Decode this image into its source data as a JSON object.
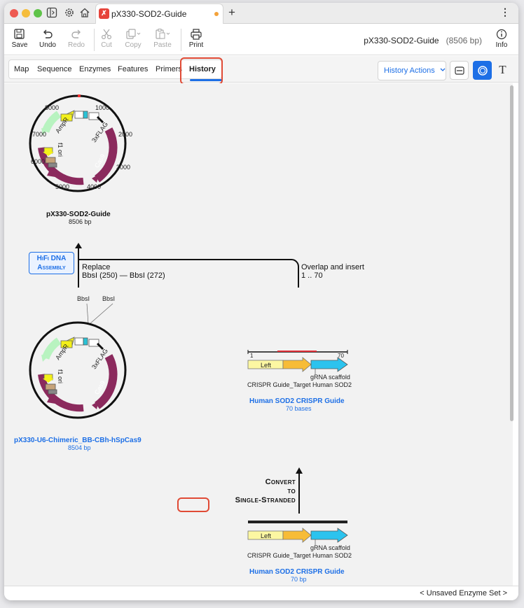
{
  "window": {
    "tab_title": "pX330-SOD2-Guide",
    "tab_logo": "✗",
    "new_tab": "+",
    "menu": "⋮"
  },
  "toolbar": {
    "save": "Save",
    "undo": "Undo",
    "redo": "Redo",
    "cut": "Cut",
    "copy": "Copy",
    "paste": "Paste",
    "print": "Print",
    "info": "Info",
    "doc_name": "pX330-SOD2-Guide",
    "doc_size": "(8506 bp)"
  },
  "view_tabs": [
    "Map",
    "Sequence",
    "Enzymes",
    "Features",
    "Primers",
    "History"
  ],
  "history_actions": "History Actions",
  "canvas": {
    "top_map": {
      "name": "pX330-SOD2-Guide",
      "size": "8506 bp",
      "ticks": [
        "1000",
        "2000",
        "3000",
        "4000",
        "5000",
        "6000",
        "7000",
        "8000"
      ],
      "features": [
        "3xFLAG",
        "Cas9",
        "AmpR",
        "f1 ori"
      ]
    },
    "operation": {
      "badge": "HiFi DNA Assembly",
      "left_label": "Replace",
      "left_detail": "BbsI (250)  —  BbsI (272)",
      "right_label": "Overlap and insert",
      "right_detail": "1 .. 70"
    },
    "bottom_map": {
      "name": "pX330-U6-Chimeric_BB-CBh-hSpCas9",
      "size": "8504 bp",
      "sites": [
        "BbsI",
        "BbsI"
      ],
      "features": [
        "3xFLAG",
        "Cas9",
        "AmpR",
        "f1 ori"
      ]
    },
    "guide_linear": {
      "start": "1",
      "end": "70",
      "left": "Left",
      "scaffold": "gRNA scaffold",
      "target": "CRISPR Guide_Target Human SOD2",
      "name": "Human SOD2 CRISPR Guide",
      "size": "70 bases"
    },
    "convert": [
      "Convert",
      "to",
      "Single-Stranded"
    ],
    "guide_ds": {
      "left": "Left",
      "scaffold": "gRNA scaffold",
      "target": "CRISPR Guide_Target Human SOD2",
      "name": "Human SOD2 CRISPR Guide",
      "size": "70 bp"
    }
  },
  "status": {
    "enzyme_set": "< Unsaved Enzyme Set >"
  },
  "colors": {
    "accent": "#1d6fe6",
    "highlight": "#e04a35",
    "cas9": "#8b2a5d",
    "promoter": "#f3f01a"
  }
}
